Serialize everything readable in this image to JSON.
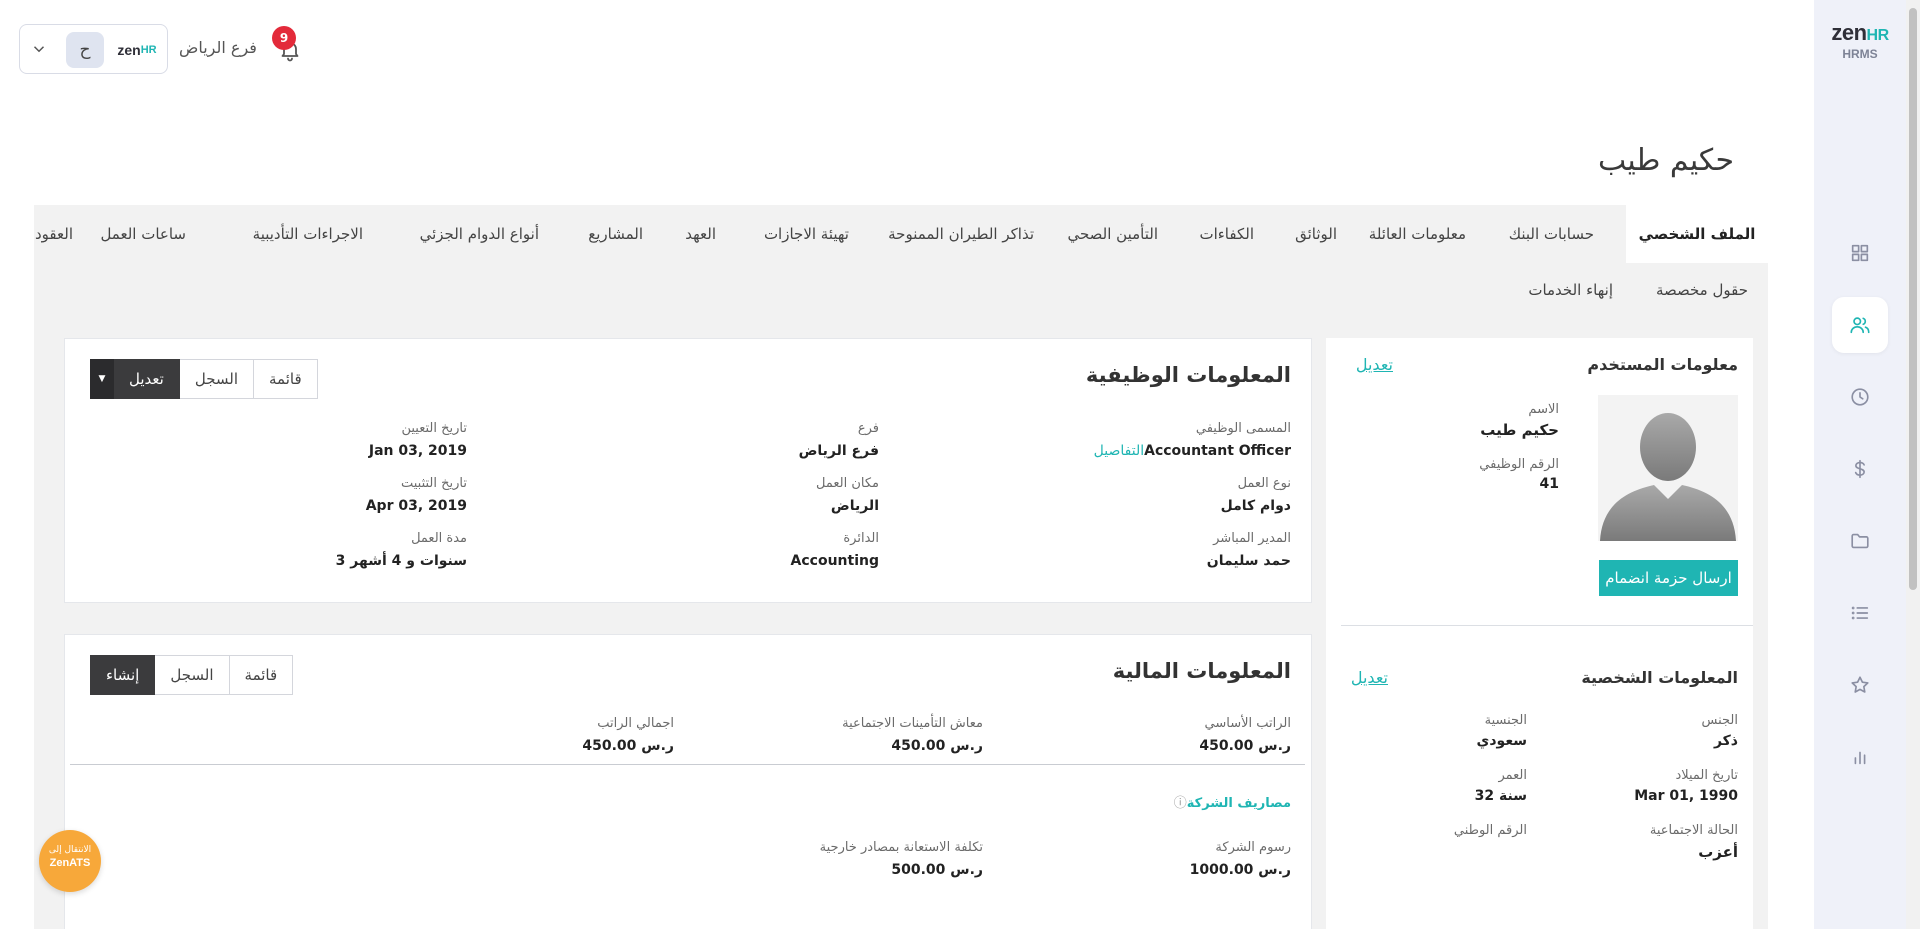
{
  "brand": {
    "logo_main": "zen",
    "logo_accent": "HR",
    "logo_sub": "HRMS"
  },
  "topbar": {
    "branch": "فرع الرياض",
    "notifications_count": "9",
    "user_initial": "ح",
    "mini_logo_main": "zen",
    "mini_logo_accent": "HR"
  },
  "employee": {
    "name": "حكيم طيب"
  },
  "tabs_row1": [
    "الملف الشخصي",
    "حسابات البنك",
    "معلومات العائلة",
    "الوثائق",
    "الكفاءات",
    "التأمين الصحي",
    "تذاكر الطيران الممنوحة",
    "تهيئة الاجازات",
    "العهد",
    "المشاريع",
    "أنواع الدوام الجزئي",
    "الاجراءات التأديبية",
    "ساعات العمل",
    "العقود"
  ],
  "tabs_row2": [
    "حقول مخصصة",
    "إنهاء الخدمات"
  ],
  "user_info": {
    "title": "معلومات المستخدم",
    "edit": "تعديل",
    "name_label": "الاسم",
    "name_value": "حكيم طيب",
    "id_label": "الرقم الوظيفي",
    "id_value": "41",
    "send_button": "ارسال حزمة انضمام"
  },
  "personal_info": {
    "title": "المعلومات الشخصية",
    "edit": "تعديل",
    "gender_label": "الجنس",
    "gender_value": "ذكر",
    "nationality_label": "الجنسية",
    "nationality_value": "سعودي",
    "dob_label": "تاريخ الميلاد",
    "dob_value": "Mar 01, 1990",
    "age_label": "العمر",
    "age_value": "32 سنة",
    "marital_label": "الحالة الاجتماعية",
    "marital_value": "أعزب",
    "national_id_label": "الرقم الوطني"
  },
  "job_info": {
    "title": "المعلومات الوظيفية",
    "btn_list": "قائمة",
    "btn_history": "السجل",
    "btn_edit": "تعديل",
    "job_title_label": "المسمى الوظيفي",
    "job_title_value": "Accountant Officer",
    "details_link": "التفاصيل",
    "branch_label": "فرع",
    "branch_value": "فرع الرياض",
    "hire_date_label": "تاريخ التعيين",
    "hire_date_value": "Jan 03, 2019",
    "work_type_label": "نوع العمل",
    "work_type_value": "دوام كامل",
    "work_place_label": "مكان العمل",
    "work_place_value": "الرياض",
    "confirm_date_label": "تاريخ التثبيت",
    "confirm_date_value": "Apr 03, 2019",
    "manager_label": "المدير المباشر",
    "manager_value": "حمد سليمان",
    "department_label": "الدائرة",
    "department_value": "Accounting",
    "duration_label": "مدة العمل",
    "duration_value": "3 سنوات و 4 أشهر"
  },
  "financial_info": {
    "title": "المعلومات المالية",
    "btn_list": "قائمة",
    "btn_history": "السجل",
    "btn_create": "إنشاء",
    "basic_salary_label": "الراتب الأساسي",
    "basic_salary_value": "450.00 ر.س",
    "gosi_salary_label": "معاش التأمينات الاجتماعية",
    "gosi_salary_value": "450.00 ر.س",
    "total_salary_label": "اجمالي الراتب",
    "total_salary_value": "450.00 ر.س",
    "company_expenses": "مصاريف الشركة",
    "company_fees_label": "رسوم الشركة",
    "company_fees_value": "1000.00 ر.س",
    "outsourcing_label": "تكلفة الاستعانة بمصادر خارجية",
    "outsourcing_value": "500.00 ر.س"
  },
  "fab": {
    "line1": "الانتقال إلى",
    "line2": "ZenATS"
  }
}
